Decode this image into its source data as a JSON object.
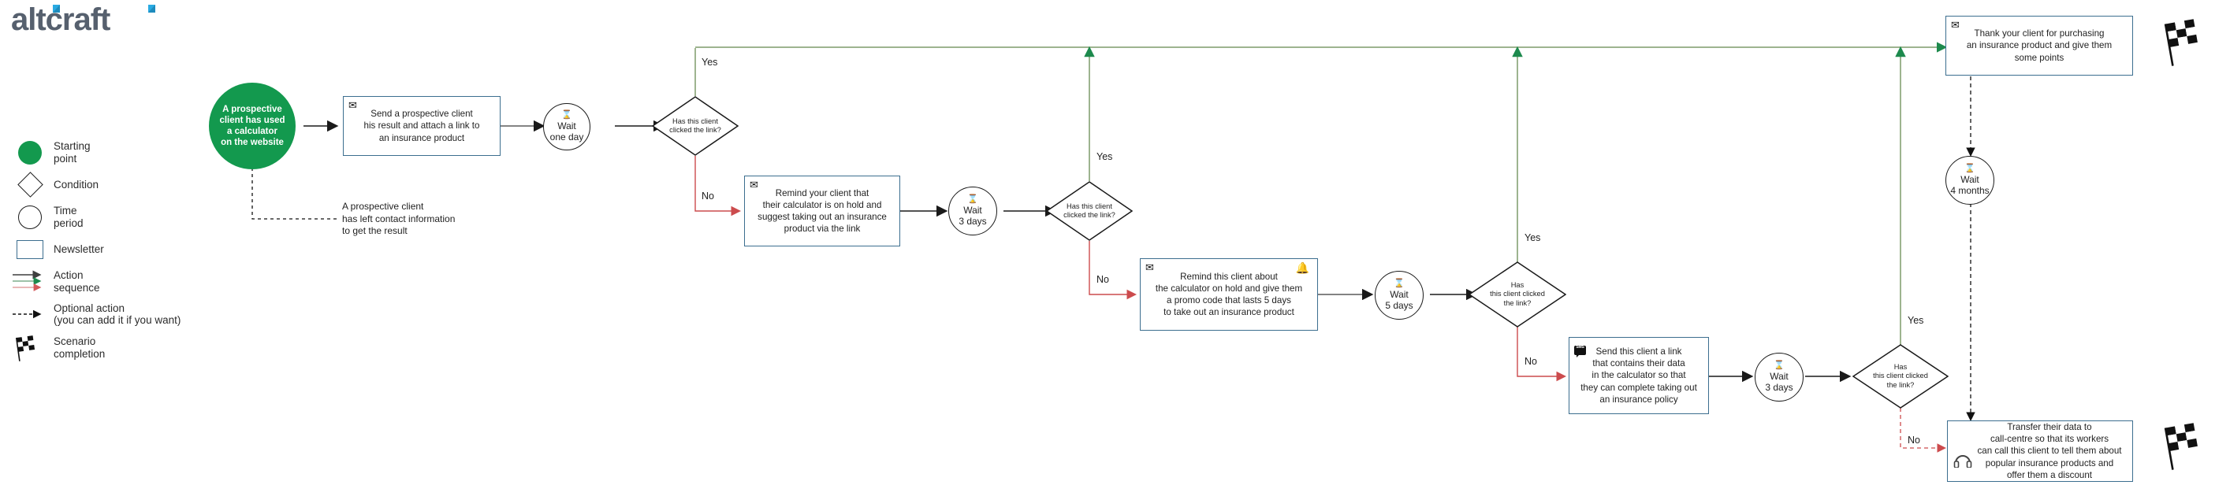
{
  "brand": {
    "name": "altcraft",
    "text_color": "#56606e",
    "accent_color": "#29aae2"
  },
  "legend": {
    "items": [
      {
        "glyph": "filled-green-circle",
        "label": "Starting\npoint"
      },
      {
        "glyph": "diamond-outline",
        "label": "Condition"
      },
      {
        "glyph": "circle-outline",
        "label": "Time\nperiod"
      },
      {
        "glyph": "rectangle-outline",
        "label": "Newsletter"
      },
      {
        "glyph": "three-arrows",
        "label": "Action\nsequence"
      },
      {
        "glyph": "dashed-arrow",
        "label": "Optional action\n(you can add it if you want)"
      },
      {
        "glyph": "checkered-flag",
        "label": "Scenario\ncompletion"
      }
    ]
  },
  "colors": {
    "green": "#13994e",
    "green_line": "#7d9b6a",
    "red_line": "#d4595b",
    "black_line": "#1a1a1a",
    "box_border": "#3c6e8f",
    "text": "#1f1f1f"
  },
  "nodes": {
    "start": {
      "type": "starting-point",
      "label": "A prospective\nclient has used\na calculator\non the website"
    },
    "msg_1": {
      "type": "newsletter",
      "icon": "envelope-icon",
      "label": "Send a prospective client\nhis result and attach a link to\nan insurance product"
    },
    "wait_1": {
      "type": "time-period",
      "icon": "hourglass-icon",
      "label": "Wait\none day"
    },
    "cond_1": {
      "type": "condition",
      "label": "Has this client\nclicked the link?"
    },
    "msg_2": {
      "type": "newsletter",
      "icon": "envelope-icon",
      "label": "Remind your client that\ntheir calculator is on hold and\nsuggest taking out an insurance\nproduct via the link"
    },
    "wait_2": {
      "type": "time-period",
      "icon": "hourglass-icon",
      "label": "Wait\n3 days"
    },
    "cond_2": {
      "type": "condition",
      "label": "Has this client\nclicked the link?"
    },
    "msg_3": {
      "type": "newsletter",
      "icon": "envelope-icon",
      "icon2": "bell-icon",
      "label": "Remind this client about\nthe calculator on hold and give them\na promo code that lasts 5 days\nto take out an insurance product"
    },
    "wait_3": {
      "type": "time-period",
      "icon": "hourglass-icon",
      "label": "Wait\n5 days"
    },
    "cond_3": {
      "type": "condition",
      "label": "Has\nthis client clicked\nthe link?"
    },
    "msg_4": {
      "type": "newsletter",
      "icon": "sms-icon",
      "label": "Send this client a link\nthat contains their data\nin the calculator so that\nthey can complete taking out\nan insurance policy"
    },
    "wait_4": {
      "type": "time-period",
      "icon": "hourglass-icon",
      "label": "Wait\n3 days"
    },
    "cond_4": {
      "type": "condition",
      "label": "Has\nthis client clicked\nthe link?"
    },
    "msg_thanks": {
      "type": "newsletter",
      "icon": "envelope-icon",
      "label": "Thank your client for purchasing\nan insurance product and give them\nsome points"
    },
    "wait_5": {
      "type": "time-period",
      "icon": "hourglass-icon",
      "label": "Wait\n4 months"
    },
    "msg_callcentre": {
      "type": "newsletter",
      "icon": "headset-icon",
      "label": "Transfer their data to\ncall-centre so that  its workers\ncan call this client to tell them about\npopular insurance products and\noffer them a discount"
    },
    "flag_top": {
      "type": "scenario-completion"
    },
    "flag_bottom": {
      "type": "scenario-completion"
    }
  },
  "edge_labels": {
    "yes_1": "Yes",
    "no_1": "No",
    "yes_2": "Yes",
    "no_2": "No",
    "yes_3": "Yes",
    "no_3": "No",
    "yes_4": "Yes",
    "no_4": "No"
  },
  "notes": {
    "optional_start": "A prospective client\nhas left contact information\nto get the result"
  }
}
